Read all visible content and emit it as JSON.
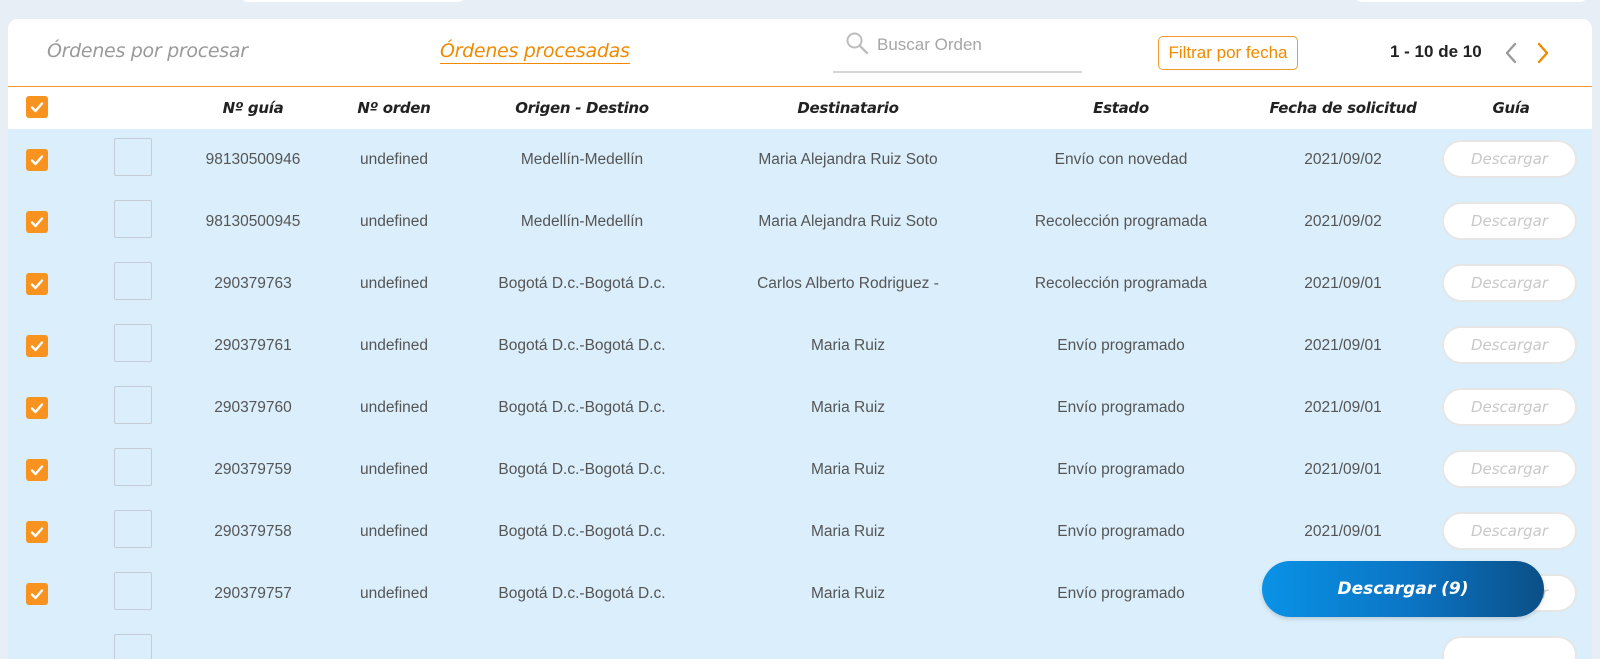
{
  "tabs": {
    "pending": "Órdenes por procesar",
    "processed": "Órdenes procesadas"
  },
  "search": {
    "placeholder": "Buscar Orden"
  },
  "filter_label": "Filtrar por fecha",
  "pagination": {
    "range": "1 - 10 de 10"
  },
  "colors": {
    "accent": "#f7931e",
    "row_bg": "#daeefb",
    "bulk_button": "#0a7fd1"
  },
  "columns": {
    "guia_num": "Nº guía",
    "orden_num": "Nº orden",
    "origen_destino": "Origen - Destino",
    "destinatario": "Destinatario",
    "estado": "Estado",
    "fecha": "Fecha de solicitud",
    "guia": "Guía"
  },
  "download_label": "Descargar",
  "rows": [
    {
      "guia": "98130500946",
      "orden": "undefined",
      "ruta": "Medellín-Medellín",
      "destinatario": "Maria Alejandra Ruiz Soto",
      "estado": "Envío con novedad",
      "fecha": "2021/09/02"
    },
    {
      "guia": "98130500945",
      "orden": "undefined",
      "ruta": "Medellín-Medellín",
      "destinatario": "Maria Alejandra Ruiz Soto",
      "estado": "Recolección programada",
      "fecha": "2021/09/02"
    },
    {
      "guia": "290379763",
      "orden": "undefined",
      "ruta": "Bogotá D.c.-Bogotá D.c.",
      "destinatario": "Carlos Alberto Rodriguez -",
      "estado": "Recolección programada",
      "fecha": "2021/09/01"
    },
    {
      "guia": "290379761",
      "orden": "undefined",
      "ruta": "Bogotá D.c.-Bogotá D.c.",
      "destinatario": "Maria Ruiz",
      "estado": "Envío programado",
      "fecha": "2021/09/01"
    },
    {
      "guia": "290379760",
      "orden": "undefined",
      "ruta": "Bogotá D.c.-Bogotá D.c.",
      "destinatario": "Maria Ruiz",
      "estado": "Envío programado",
      "fecha": "2021/09/01"
    },
    {
      "guia": "290379759",
      "orden": "undefined",
      "ruta": "Bogotá D.c.-Bogotá D.c.",
      "destinatario": "Maria Ruiz",
      "estado": "Envío programado",
      "fecha": "2021/09/01"
    },
    {
      "guia": "290379758",
      "orden": "undefined",
      "ruta": "Bogotá D.c.-Bogotá D.c.",
      "destinatario": "Maria Ruiz",
      "estado": "Envío programado",
      "fecha": "2021/09/01"
    },
    {
      "guia": "290379757",
      "orden": "undefined",
      "ruta": "Bogotá D.c.-Bogotá D.c.",
      "destinatario": "Maria Ruiz",
      "estado": "Envío programado",
      "fecha": ""
    }
  ],
  "bulk_download_label": "Descargar (9)"
}
